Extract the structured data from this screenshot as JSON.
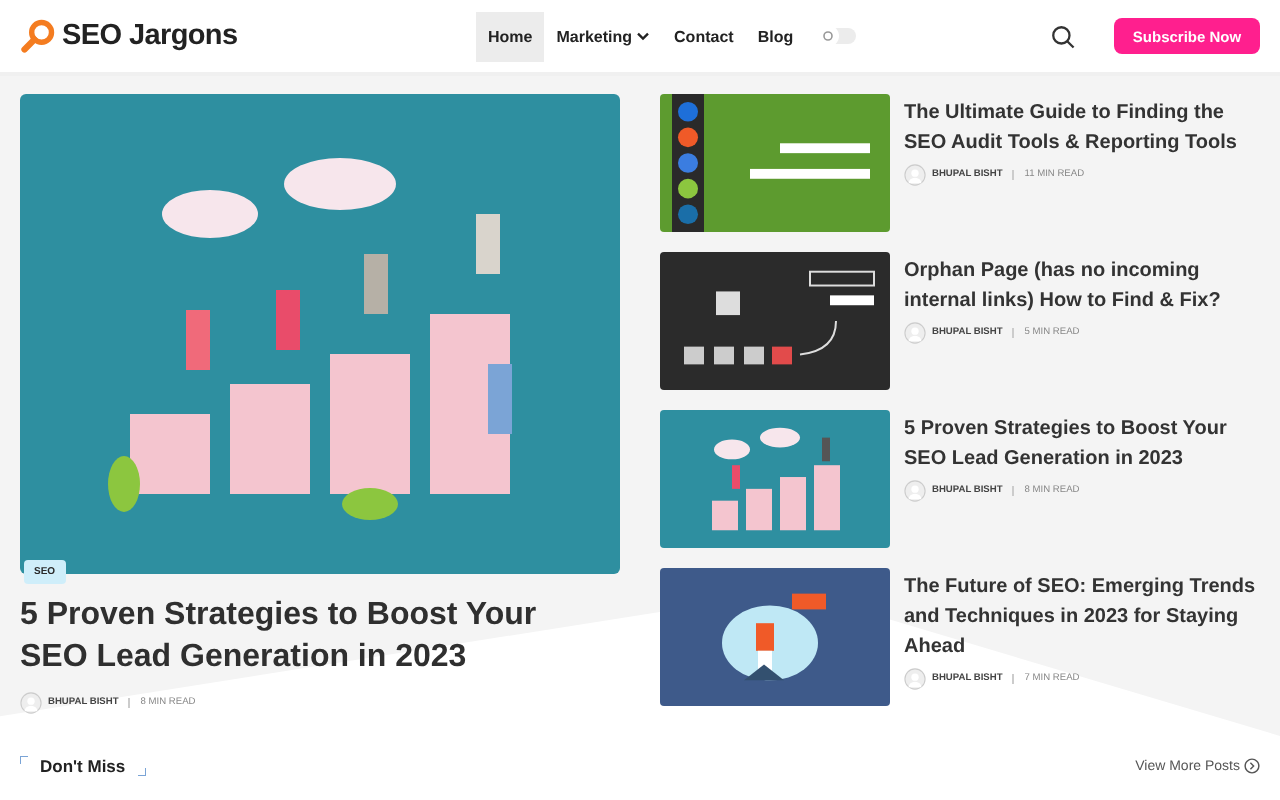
{
  "header": {
    "logo": "SEO Jargons",
    "nav": [
      {
        "label": "Home",
        "selected": true,
        "has_menu": false
      },
      {
        "label": "Marketing",
        "selected": false,
        "has_menu": true
      },
      {
        "label": "Contact",
        "selected": false,
        "has_menu": false
      },
      {
        "label": "Blog",
        "selected": false,
        "has_menu": false
      }
    ],
    "theme_toggle": {
      "on": false
    },
    "subscribe": "Subscribe Now"
  },
  "featured": {
    "tag": "SEO",
    "title": "5 Proven Strategies to Boost Your SEO Lead Generation in 2023",
    "author": "BHUPAL BISHT",
    "read_time": "8 MIN READ"
  },
  "posts": [
    {
      "kind": "tools",
      "title": "The Ultimate Guide to Finding the SEO Audit Tools & Reporting Tools",
      "author": "BHUPAL BISHT",
      "read_time": "11 MIN READ"
    },
    {
      "kind": "orphan",
      "title": "Orphan Page (has no incoming internal links) How to Find & Fix?",
      "author": "BHUPAL BISHT",
      "read_time": "5 MIN READ"
    },
    {
      "kind": "growth",
      "title": "5 Proven Strategies to Boost Your SEO Lead Generation in 2023",
      "author": "BHUPAL BISHT",
      "read_time": "8 MIN READ"
    },
    {
      "kind": "future",
      "title": "The Future of SEO: Emerging Trends and Techniques in 2023 for Staying Ahead",
      "author": "BHUPAL BISHT",
      "read_time": "7 MIN READ"
    }
  ],
  "section": {
    "title": "Don't Miss",
    "link": "View More Posts"
  }
}
